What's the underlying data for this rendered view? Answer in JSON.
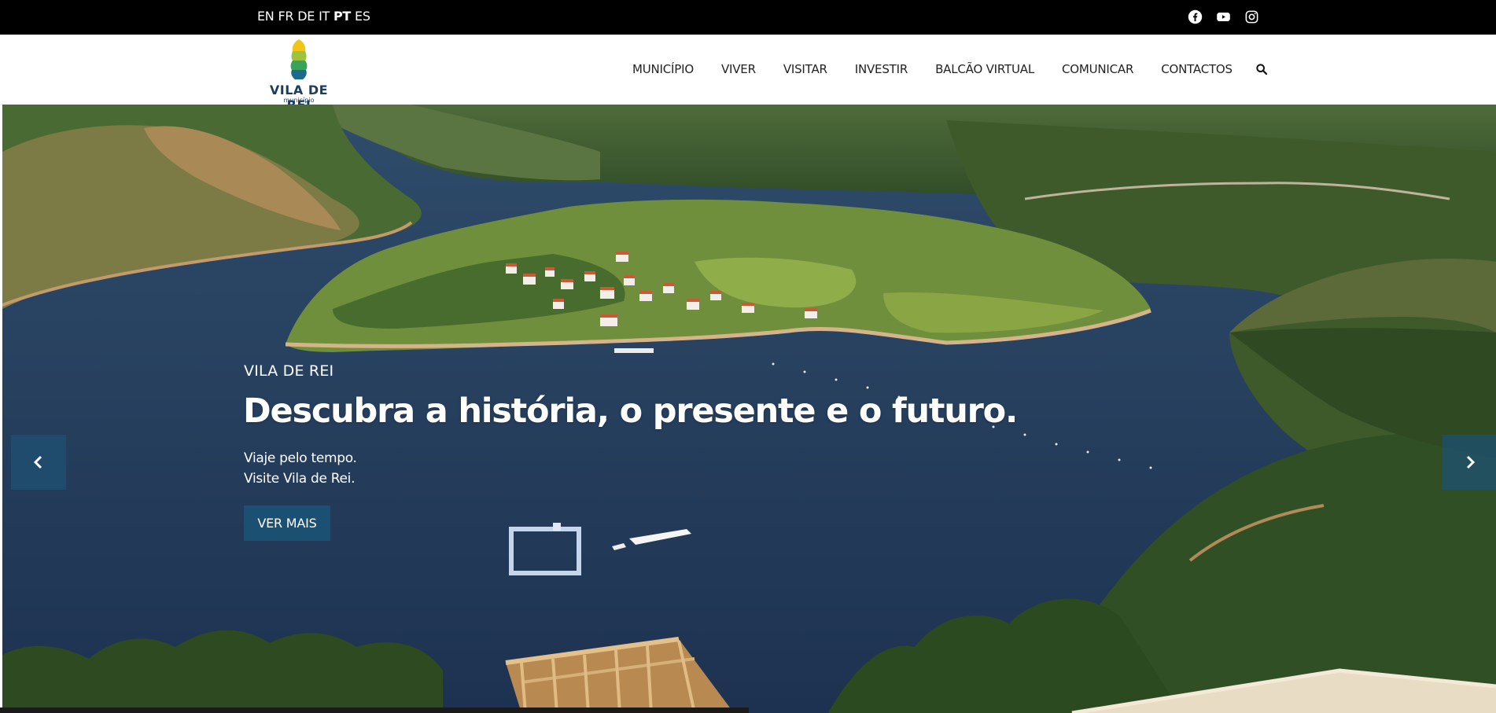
{
  "topbar": {
    "languages": [
      {
        "code": "EN",
        "active": false
      },
      {
        "code": "FR",
        "active": false
      },
      {
        "code": "DE",
        "active": false
      },
      {
        "code": "IT",
        "active": false
      },
      {
        "code": "PT",
        "active": true
      },
      {
        "code": "ES",
        "active": false
      }
    ],
    "social_icons": [
      "facebook-icon",
      "youtube-icon",
      "instagram-icon"
    ]
  },
  "header": {
    "logo_text": "VILA DE REI",
    "logo_subtext": "município",
    "nav": [
      {
        "label": "MUNICÍPIO"
      },
      {
        "label": "VIVER"
      },
      {
        "label": "VISITAR"
      },
      {
        "label": "INVESTIR"
      },
      {
        "label": "BALCÃO VIRTUAL"
      },
      {
        "label": "COMUNICAR"
      },
      {
        "label": "CONTACTOS"
      }
    ],
    "search_icon": "search-icon"
  },
  "hero": {
    "eyebrow": "VILA DE REI",
    "title": "Descubra a história, o presente e o futuro.",
    "subtitle_lines": [
      "Viaje pelo tempo.",
      "Visite Vila de Rei."
    ],
    "cta_label": "VER MAIS",
    "prev_icon": "chevron-left-icon",
    "next_icon": "chevron-right-icon"
  },
  "colors": {
    "topbar": "#000000",
    "accent": "#1c5073",
    "logo_text": "#1b3e5c"
  }
}
